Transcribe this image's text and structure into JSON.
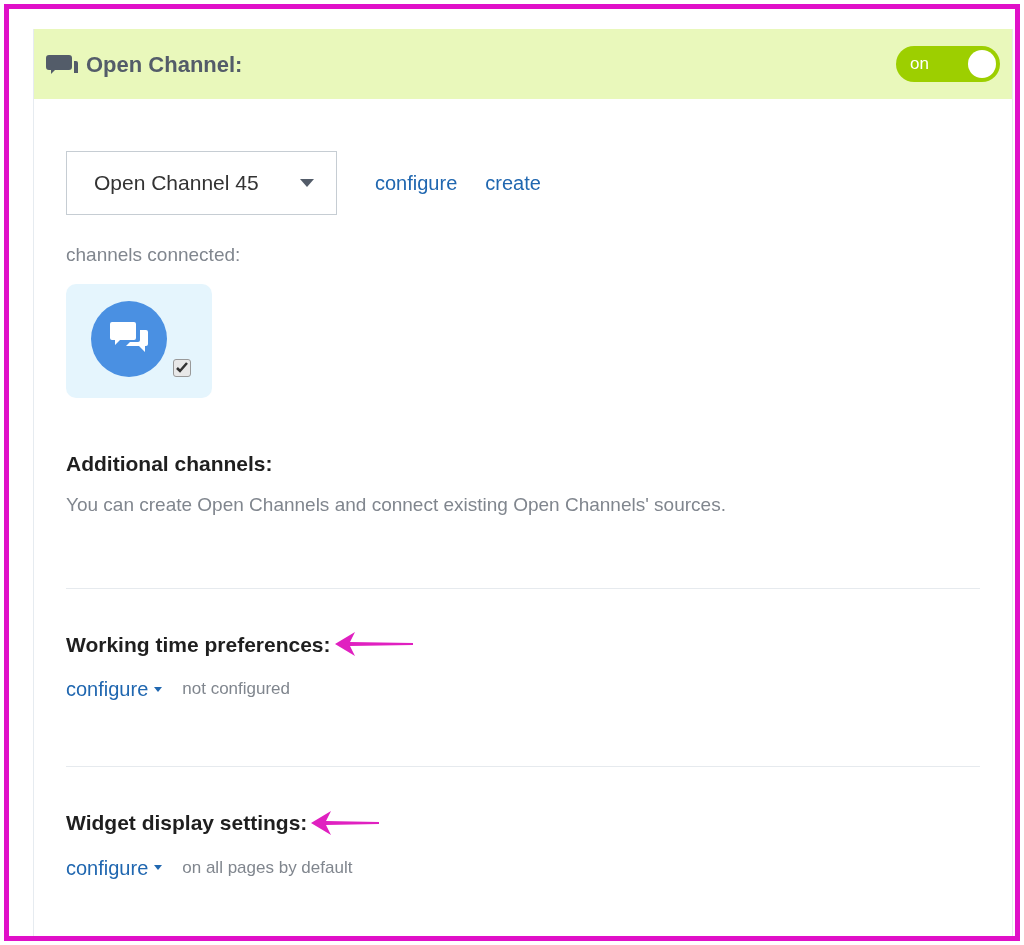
{
  "header": {
    "title": "Open Channel:",
    "toggle": {
      "label": "on",
      "on": true
    }
  },
  "selector": {
    "value": "Open Channel 45",
    "links": [
      "configure",
      "create"
    ]
  },
  "connected": {
    "label": "channels connected:",
    "channels": [
      {
        "checked": true
      }
    ]
  },
  "additional": {
    "title": "Additional channels:",
    "text": "You can create Open Channels and connect existing Open Channels' sources."
  },
  "sections": [
    {
      "title": "Working time preferences:",
      "link": "configure",
      "status": "not configured",
      "highlighted": true
    },
    {
      "title": "Widget display settings:",
      "link": "configure",
      "status": "on all pages by default",
      "highlighted": true
    }
  ]
}
